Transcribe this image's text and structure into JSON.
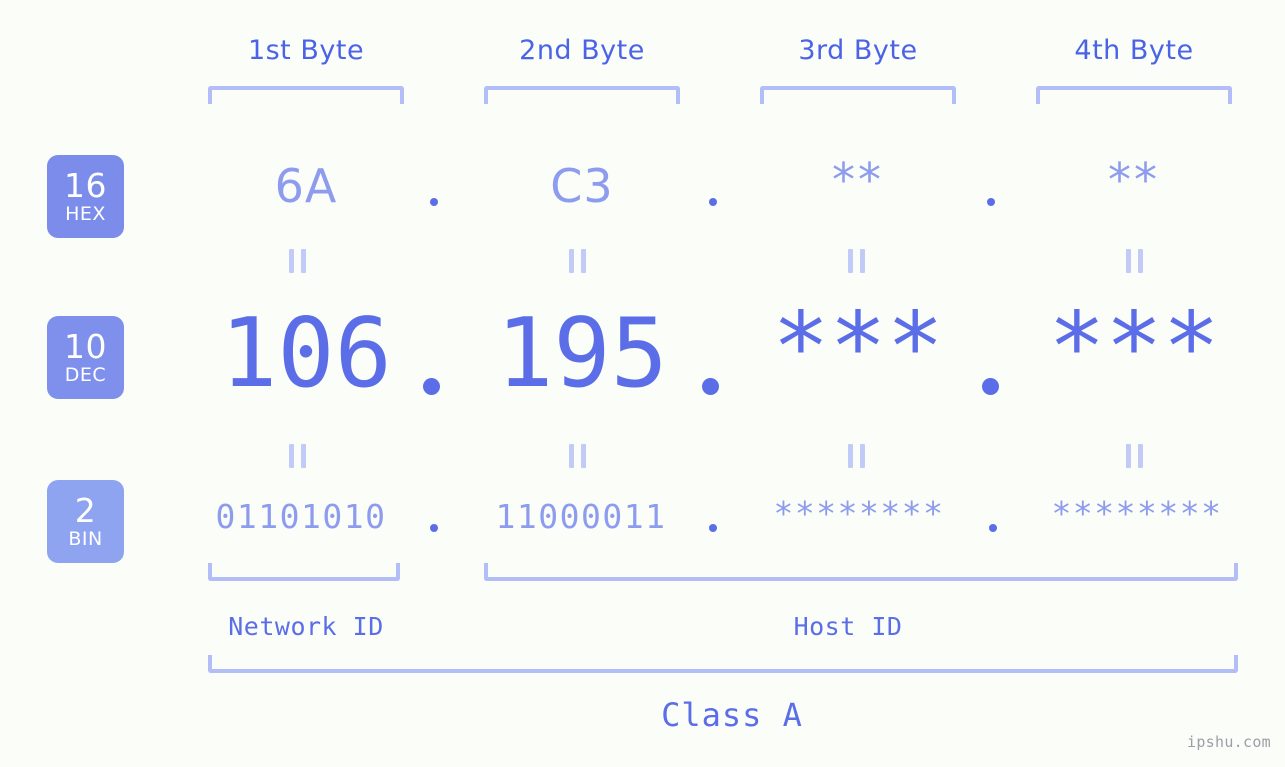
{
  "theme": {
    "background": "#fbfdf8",
    "accent_strong": "#5b6ee8",
    "accent_mid": "#8d9cee",
    "accent_light": "#b3bdf7",
    "badge_hex": "#7b8ceb",
    "badge_dec": "#7f90ec",
    "badge_bin": "#8fa4f0",
    "header_text": "#4a63e7",
    "watermark_text": "#9aa0a6"
  },
  "header": {
    "bytes": [
      {
        "label": "1st Byte"
      },
      {
        "label": "2nd Byte"
      },
      {
        "label": "3rd Byte"
      },
      {
        "label": "4th Byte"
      }
    ]
  },
  "bases": [
    {
      "number": "16",
      "name": "HEX"
    },
    {
      "number": "10",
      "name": "DEC"
    },
    {
      "number": "2",
      "name": "BIN"
    }
  ],
  "rows": {
    "hex": {
      "base_number": "16",
      "base_name": "HEX",
      "values": [
        "6A",
        "C3",
        "**",
        "**"
      ],
      "separator": "."
    },
    "dec": {
      "base_number": "10",
      "base_name": "DEC",
      "values": [
        "106",
        "195",
        "***",
        "***"
      ],
      "separator": "."
    },
    "bin": {
      "base_number": "2",
      "base_name": "BIN",
      "values": [
        "01101010",
        "11000011",
        "********",
        "********"
      ],
      "separator": "."
    }
  },
  "equality_marker": "||",
  "footer": {
    "network_id_label": "Network ID",
    "host_id_label": "Host ID",
    "class_label": "Class A"
  },
  "watermark": "ipshu.com"
}
